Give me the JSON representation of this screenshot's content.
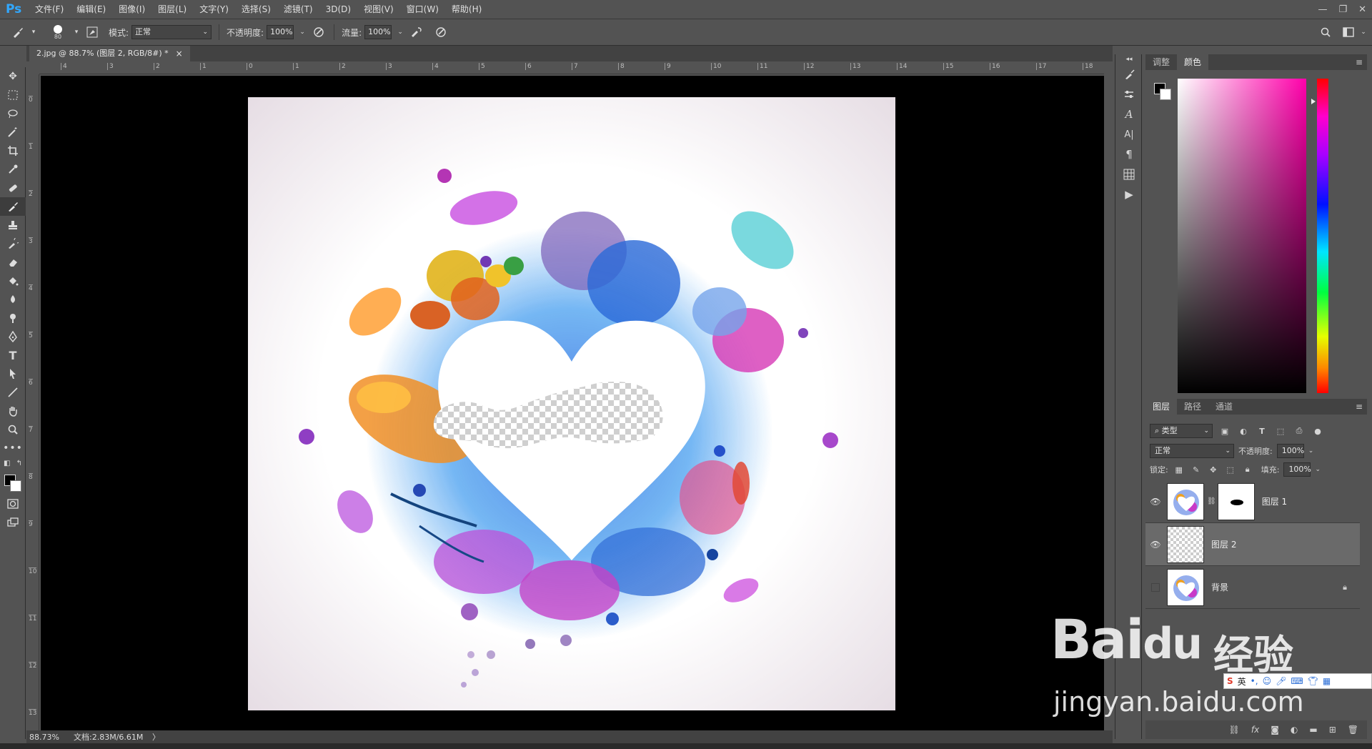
{
  "app": {
    "logo": "Ps"
  },
  "menu": [
    "文件(F)",
    "编辑(E)",
    "图像(I)",
    "图层(L)",
    "文字(Y)",
    "选择(S)",
    "滤镜(T)",
    "3D(D)",
    "视图(V)",
    "窗口(W)",
    "帮助(H)"
  ],
  "window_controls": {
    "minimize": "—",
    "restore": "❐",
    "close": "✕"
  },
  "options": {
    "brush_size": "80",
    "mode_label": "模式:",
    "mode_value": "正常",
    "opacity_label": "不透明度:",
    "opacity_value": "100%",
    "flow_label": "流量:",
    "flow_value": "100%"
  },
  "document": {
    "tab_title": "2.jpg @ 88.7% (图层 2, RGB/8#) *",
    "close": "×"
  },
  "rulers": {
    "h_ticks": [
      "4",
      "3",
      "2",
      "1",
      "0",
      "1",
      "2",
      "3",
      "4",
      "5",
      "6",
      "7",
      "8",
      "9",
      "10",
      "11",
      "12",
      "13",
      "14",
      "15",
      "16",
      "17",
      "18"
    ],
    "v_ticks": [
      "0",
      "1",
      "2",
      "3",
      "4",
      "5",
      "6",
      "7",
      "8",
      "9",
      "10",
      "11",
      "12",
      "13"
    ]
  },
  "tools": [
    "move",
    "marquee",
    "lasso",
    "magic-wand",
    "crop",
    "eyedropper",
    "healing",
    "brush",
    "stamp",
    "history-brush",
    "eraser",
    "bucket",
    "blur",
    "dodge",
    "pen",
    "type",
    "path-select",
    "line",
    "hand",
    "zoom",
    "more"
  ],
  "color_panel": {
    "tabs": [
      "调整",
      "颜色"
    ],
    "active_tab": "颜色",
    "foreground": "#000000",
    "background": "#ffffff"
  },
  "layers_panel": {
    "tabs": [
      "图层",
      "路径",
      "通道"
    ],
    "active_tab": "图层",
    "filter_kind": "类型",
    "blend_mode": "正常",
    "opacity_label": "不透明度:",
    "opacity_value": "100%",
    "lock_label": "锁定:",
    "fill_label": "填充:",
    "fill_value": "100%",
    "layers": [
      {
        "name": "图层 1",
        "visible": true,
        "has_mask": true,
        "selected": false,
        "locked": false
      },
      {
        "name": "图层 2",
        "visible": true,
        "has_mask": false,
        "selected": true,
        "locked": false
      },
      {
        "name": "背景",
        "visible": false,
        "has_mask": false,
        "selected": false,
        "locked": true
      }
    ],
    "footer_icons": [
      "link-icon",
      "fx-icon",
      "mask-icon",
      "adjustment-icon",
      "group-icon",
      "new-layer-icon",
      "trash-icon"
    ]
  },
  "status": {
    "zoom": "88.73%",
    "doc_info": "文档:2.83M/6.61M",
    "arrow": "〉"
  },
  "watermark": {
    "brand": "Bai",
    "brand_du": "du",
    "cn": "经验",
    "url": "jingyan.baidu.com"
  },
  "ime": {
    "lang": "英"
  }
}
